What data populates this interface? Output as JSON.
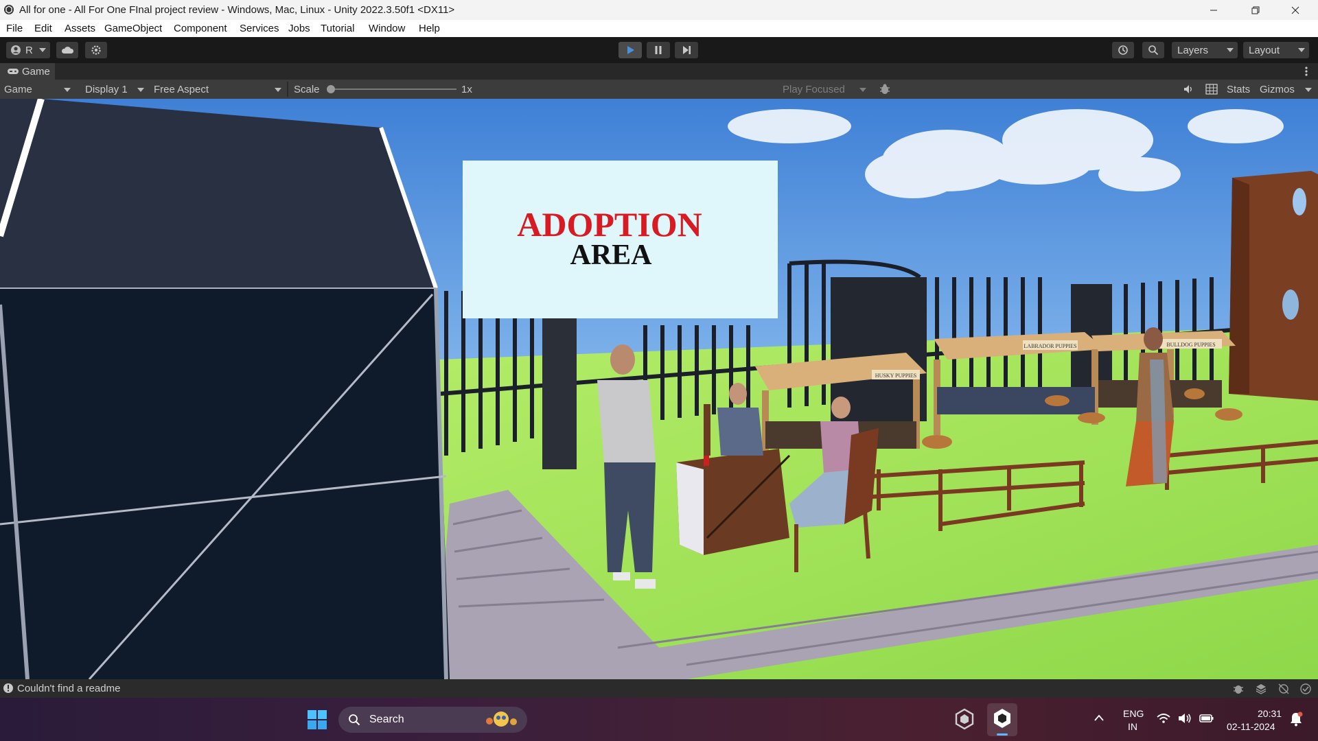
{
  "window": {
    "title": "All for one - All For One FInal project review - Windows, Mac, Linux - Unity 2022.3.50f1 <DX11>",
    "controls": [
      "minimize",
      "restore",
      "close"
    ]
  },
  "menu": [
    "File",
    "Edit",
    "Assets",
    "GameObject",
    "Component",
    "Services",
    "Jobs",
    "Tutorial",
    "Window",
    "Help"
  ],
  "toolbar": {
    "account_label": "R",
    "layers_label": "Layers",
    "layout_label": "Layout"
  },
  "game_tab": {
    "label": "Game",
    "mode_label": "Game",
    "display_label": "Display 1",
    "aspect_label": "Free Aspect",
    "scale_label": "Scale",
    "scale_value": "1x",
    "play_focused_label": "Play Focused",
    "stats_label": "Stats",
    "gizmos_label": "Gizmos"
  },
  "scene": {
    "sign_line1": "ADOPTION",
    "sign_line2": "AREA",
    "stall_labels": [
      "HUSKY PUPPIES",
      "LABRADOR PUPPIES",
      "BULLDOG PUPPIES"
    ]
  },
  "status": {
    "message": "Couldn't find a readme"
  },
  "taskbar": {
    "search_placeholder": "Search",
    "lang_line1": "ENG",
    "lang_line2": "IN",
    "time": "20:31",
    "date": "02-11-2024"
  },
  "colors": {
    "sign_red": "#d81b22",
    "editor_dark": "#191919",
    "play_blue": "#4a90d9"
  },
  "icons": [
    "unity-logo-icon",
    "account-icon",
    "cloud-icon",
    "settings-icon",
    "play-icon",
    "pause-icon",
    "step-icon",
    "history-icon",
    "search-icon",
    "gamepad-icon",
    "bug-icon",
    "audio-icon",
    "grid-icon",
    "kebab-menu-icon",
    "windows-start-icon",
    "wifi-icon",
    "volume-icon",
    "battery-icon",
    "notification-icon",
    "chevron-up-icon"
  ]
}
